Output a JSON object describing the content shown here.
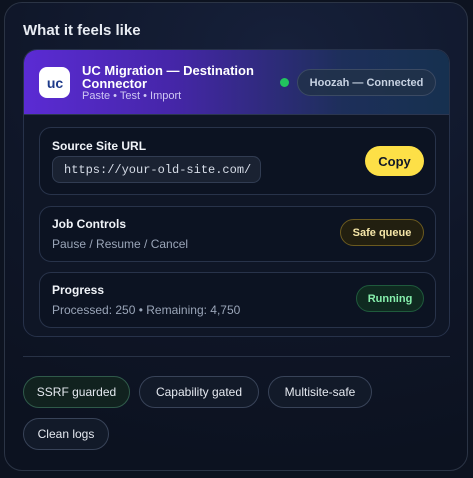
{
  "section_title": "What it feels like",
  "app": {
    "logo_text": "uc",
    "title": "UC Migration — Destination Connector",
    "subtitle": "Paste • Test • Import",
    "connection_label": "Hoozah — Connected",
    "connection_status_color": "#22c55e"
  },
  "source": {
    "label": "Source Site URL",
    "url_value": "https://your-old-site.com/",
    "copy_label": "Copy"
  },
  "job_controls": {
    "label": "Job Controls",
    "actions_text": "Pause / Resume / Cancel",
    "badge": "Safe queue"
  },
  "progress": {
    "label": "Progress",
    "stats_text": "Processed: 250 • Remaining: 4,750",
    "badge": "Running"
  },
  "chips": [
    "SSRF guarded",
    "Capability gated",
    "Multisite-safe",
    "Clean logs"
  ],
  "colors": {
    "accent_yellow": "#fde047",
    "header_purple": "#5b2bd4",
    "running_green": "#86efac",
    "safe_queue_gold": "#f5e6a8"
  }
}
